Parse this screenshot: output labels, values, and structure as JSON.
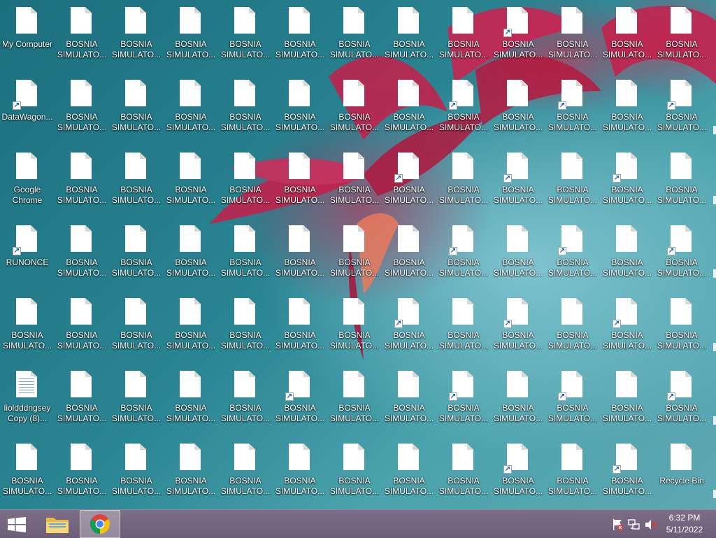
{
  "desktop": {
    "icons": [
      {
        "label": "My Computer",
        "type": "doc",
        "shortcut": false
      },
      {
        "label": "BOSNIA\nSIMULATO...",
        "type": "doc",
        "shortcut": false
      },
      {
        "label": "BOSNIA\nSIMULATO...",
        "type": "doc",
        "shortcut": false
      },
      {
        "label": "BOSNIA\nSIMULATO...",
        "type": "doc",
        "shortcut": false
      },
      {
        "label": "BOSNIA\nSIMULATO...",
        "type": "doc",
        "shortcut": false
      },
      {
        "label": "BOSNIA\nSIMULATO...",
        "type": "doc",
        "shortcut": false
      },
      {
        "label": "BOSNIA\nSIMULATO...",
        "type": "doc",
        "shortcut": false
      },
      {
        "label": "BOSNIA\nSIMULATO...",
        "type": "doc",
        "shortcut": false
      },
      {
        "label": "BOSNIA\nSIMULATO...",
        "type": "doc",
        "shortcut": false
      },
      {
        "label": "BOSNIA\nSIMULATO...",
        "type": "doc",
        "shortcut": true
      },
      {
        "label": "BOSNIA\nSIMULATO...",
        "type": "doc",
        "shortcut": false
      },
      {
        "label": "BOSNIA\nSIMULATO...",
        "type": "doc",
        "shortcut": false
      },
      {
        "label": "BOSNIA\nSIMULATO...",
        "type": "doc",
        "shortcut": false
      },
      {
        "label": "DataWagon...",
        "type": "doc",
        "shortcut": true
      },
      {
        "label": "BOSNIA\nSIMULATO...",
        "type": "doc",
        "shortcut": false
      },
      {
        "label": "BOSNIA\nSIMULATO...",
        "type": "doc",
        "shortcut": false
      },
      {
        "label": "BOSNIA\nSIMULATO...",
        "type": "doc",
        "shortcut": false
      },
      {
        "label": "BOSNIA\nSIMULATO...",
        "type": "doc",
        "shortcut": false
      },
      {
        "label": "BOSNIA\nSIMULATO...",
        "type": "doc",
        "shortcut": false
      },
      {
        "label": "BOSNIA\nSIMULATO...",
        "type": "doc",
        "shortcut": false
      },
      {
        "label": "BOSNIA\nSIMULATO...",
        "type": "doc",
        "shortcut": false
      },
      {
        "label": "BOSNIA\nSIMULATO...",
        "type": "doc",
        "shortcut": true
      },
      {
        "label": "BOSNIA\nSIMULATO...",
        "type": "doc",
        "shortcut": false
      },
      {
        "label": "BOSNIA\nSIMULATO...",
        "type": "doc",
        "shortcut": true
      },
      {
        "label": "BOSNIA\nSIMULATO...",
        "type": "doc",
        "shortcut": false
      },
      {
        "label": "BOSNIA\nSIMULATO...",
        "type": "doc",
        "shortcut": true
      },
      {
        "label": "Google\nChrome",
        "type": "doc",
        "shortcut": false
      },
      {
        "label": "BOSNIA\nSIMULATO...",
        "type": "doc",
        "shortcut": false
      },
      {
        "label": "BOSNIA\nSIMULATO...",
        "type": "doc",
        "shortcut": false
      },
      {
        "label": "BOSNIA\nSIMULATO...",
        "type": "doc",
        "shortcut": false
      },
      {
        "label": "BOSNIA\nSIMULATO...",
        "type": "doc",
        "shortcut": false
      },
      {
        "label": "BOSNIA\nSIMULATO...",
        "type": "doc",
        "shortcut": false
      },
      {
        "label": "BOSNIA\nSIMULATO...",
        "type": "doc",
        "shortcut": false
      },
      {
        "label": "BOSNIA\nSIMULATO...",
        "type": "doc",
        "shortcut": true
      },
      {
        "label": "BOSNIA\nSIMULATO...",
        "type": "doc",
        "shortcut": false
      },
      {
        "label": "BOSNIA\nSIMULATO...",
        "type": "doc",
        "shortcut": true
      },
      {
        "label": "BOSNIA\nSIMULATO...",
        "type": "doc",
        "shortcut": false
      },
      {
        "label": "BOSNIA\nSIMULATO...",
        "type": "doc",
        "shortcut": true
      },
      {
        "label": "BOSNIA\nSIMULATO...",
        "type": "doc",
        "shortcut": false
      },
      {
        "label": "RUNONCE",
        "type": "doc",
        "shortcut": true
      },
      {
        "label": "BOSNIA\nSIMULATO...",
        "type": "doc",
        "shortcut": false
      },
      {
        "label": "BOSNIA\nSIMULATO...",
        "type": "doc",
        "shortcut": false
      },
      {
        "label": "BOSNIA\nSIMULATO...",
        "type": "doc",
        "shortcut": false
      },
      {
        "label": "BOSNIA\nSIMULATO...",
        "type": "doc",
        "shortcut": false
      },
      {
        "label": "BOSNIA\nSIMULATO...",
        "type": "doc",
        "shortcut": false
      },
      {
        "label": "BOSNIA\nSIMULATO...",
        "type": "doc",
        "shortcut": false
      },
      {
        "label": "BOSNIA\nSIMULATO...",
        "type": "doc",
        "shortcut": false
      },
      {
        "label": "BOSNIA\nSIMULATO...",
        "type": "doc",
        "shortcut": true
      },
      {
        "label": "BOSNIA\nSIMULATO...",
        "type": "doc",
        "shortcut": false
      },
      {
        "label": "BOSNIA\nSIMULATO...",
        "type": "doc",
        "shortcut": true
      },
      {
        "label": "BOSNIA\nSIMULATO...",
        "type": "doc",
        "shortcut": false
      },
      {
        "label": "BOSNIA\nSIMULATO...",
        "type": "doc",
        "shortcut": true
      },
      {
        "label": "BOSNIA\nSIMULATO...",
        "type": "doc",
        "shortcut": false
      },
      {
        "label": "BOSNIA\nSIMULATO...",
        "type": "doc",
        "shortcut": false
      },
      {
        "label": "BOSNIA\nSIMULATO...",
        "type": "doc",
        "shortcut": false
      },
      {
        "label": "BOSNIA\nSIMULATO...",
        "type": "doc",
        "shortcut": false
      },
      {
        "label": "BOSNIA\nSIMULATO...",
        "type": "doc",
        "shortcut": false
      },
      {
        "label": "BOSNIA\nSIMULATO...",
        "type": "doc",
        "shortcut": false
      },
      {
        "label": "BOSNIA\nSIMULATO...",
        "type": "doc",
        "shortcut": false
      },
      {
        "label": "BOSNIA\nSIMULATO...",
        "type": "doc",
        "shortcut": true
      },
      {
        "label": "BOSNIA\nSIMULATO...",
        "type": "doc",
        "shortcut": false
      },
      {
        "label": "BOSNIA\nSIMULATO...",
        "type": "doc",
        "shortcut": true
      },
      {
        "label": "BOSNIA\nSIMULATO...",
        "type": "doc",
        "shortcut": false
      },
      {
        "label": "BOSNIA\nSIMULATO...",
        "type": "doc",
        "shortcut": true
      },
      {
        "label": "BOSNIA\nSIMULATO...",
        "type": "doc",
        "shortcut": false
      },
      {
        "label": "lioldddngsey\nCopy (8)...",
        "type": "notepad",
        "shortcut": false
      },
      {
        "label": "BOSNIA\nSIMULATO...",
        "type": "doc",
        "shortcut": false
      },
      {
        "label": "BOSNIA\nSIMULATO...",
        "type": "doc",
        "shortcut": false
      },
      {
        "label": "BOSNIA\nSIMULATO...",
        "type": "doc",
        "shortcut": false
      },
      {
        "label": "BOSNIA\nSIMULATO...",
        "type": "doc",
        "shortcut": false
      },
      {
        "label": "BOSNIA\nSIMULATO...",
        "type": "doc",
        "shortcut": true
      },
      {
        "label": "BOSNIA\nSIMULATO...",
        "type": "doc",
        "shortcut": false
      },
      {
        "label": "BOSNIA\nSIMULATO...",
        "type": "doc",
        "shortcut": false
      },
      {
        "label": "BOSNIA\nSIMULATO...",
        "type": "doc",
        "shortcut": true
      },
      {
        "label": "BOSNIA\nSIMULATO...",
        "type": "doc",
        "shortcut": false
      },
      {
        "label": "BOSNIA\nSIMULATO...",
        "type": "doc",
        "shortcut": true
      },
      {
        "label": "BOSNIA\nSIMULATO...",
        "type": "doc",
        "shortcut": false
      },
      {
        "label": "BOSNIA\nSIMULATO...",
        "type": "doc",
        "shortcut": true
      },
      {
        "label": "BOSNIA\nSIMULATO...",
        "type": "doc",
        "shortcut": false
      },
      {
        "label": "BOSNIA\nSIMULATO...",
        "type": "doc",
        "shortcut": false
      },
      {
        "label": "BOSNIA\nSIMULATO...",
        "type": "doc",
        "shortcut": false
      },
      {
        "label": "BOSNIA\nSIMULATO...",
        "type": "doc",
        "shortcut": false
      },
      {
        "label": "BOSNIA\nSIMULATO...",
        "type": "doc",
        "shortcut": false
      },
      {
        "label": "BOSNIA\nSIMULATO...",
        "type": "doc",
        "shortcut": false
      },
      {
        "label": "BOSNIA\nSIMULATO...",
        "type": "doc",
        "shortcut": false
      },
      {
        "label": "BOSNIA\nSIMULATO...",
        "type": "doc",
        "shortcut": false
      },
      {
        "label": "BOSNIA\nSIMULATO...",
        "type": "doc",
        "shortcut": false
      },
      {
        "label": "BOSNIA\nSIMULATO...",
        "type": "doc",
        "shortcut": true
      },
      {
        "label": "BOSNIA\nSIMULATO...",
        "type": "doc",
        "shortcut": false
      },
      {
        "label": "BOSNIA\nSIMULATO...",
        "type": "doc",
        "shortcut": true
      },
      {
        "label": "Recycle Bin",
        "type": "doc",
        "shortcut": false
      }
    ]
  },
  "taskbar": {
    "start_icon": "windows-logo-icon",
    "pinned": [
      {
        "name": "file-explorer",
        "icon": "folder-icon"
      },
      {
        "name": "google-chrome",
        "icon": "chrome-icon",
        "active": true
      }
    ],
    "tray_icons": [
      "action-center-flag-icon",
      "network-icon",
      "volume-muted-icon"
    ],
    "time": "6:32 PM",
    "date": "5/11/2022"
  }
}
